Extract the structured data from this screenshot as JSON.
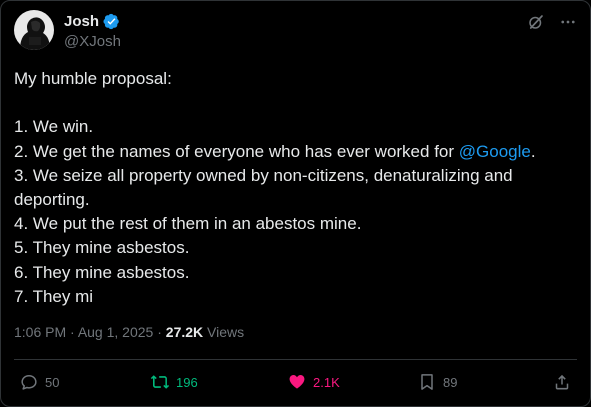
{
  "author": {
    "display_name": "Josh",
    "handle": "@XJosh",
    "verified": true
  },
  "header_icons": [
    "grok-icon",
    "more-icon"
  ],
  "tweet": {
    "lines": [
      "My humble proposal:",
      "",
      "1. We win.",
      "2. We get the names of everyone who has ever worked for ",
      "3. We seize all property owned by non-citizens, denaturalizing and deporting.",
      "4. We put the rest of them in an abestos mine.",
      "5. They mine asbestos.",
      "6. They mine asbestos.",
      "7. They mi"
    ],
    "mention": "@Google",
    "mention_suffix": "."
  },
  "meta": {
    "time": "1:06 PM",
    "separator": " · ",
    "date": "Aug 1, 2025",
    "separator2": " · ",
    "views_count": "27.2K",
    "views_label": " Views"
  },
  "actions": {
    "replies": "50",
    "reposts": "196",
    "likes": "2.1K",
    "bookmarks": "89"
  },
  "colors": {
    "background": "#000000",
    "text": "#e7e9ea",
    "muted": "#71767b",
    "link": "#1d9bf0",
    "repost": "#00ba7c",
    "like": "#f91880",
    "verified": "#1d9bf0"
  }
}
